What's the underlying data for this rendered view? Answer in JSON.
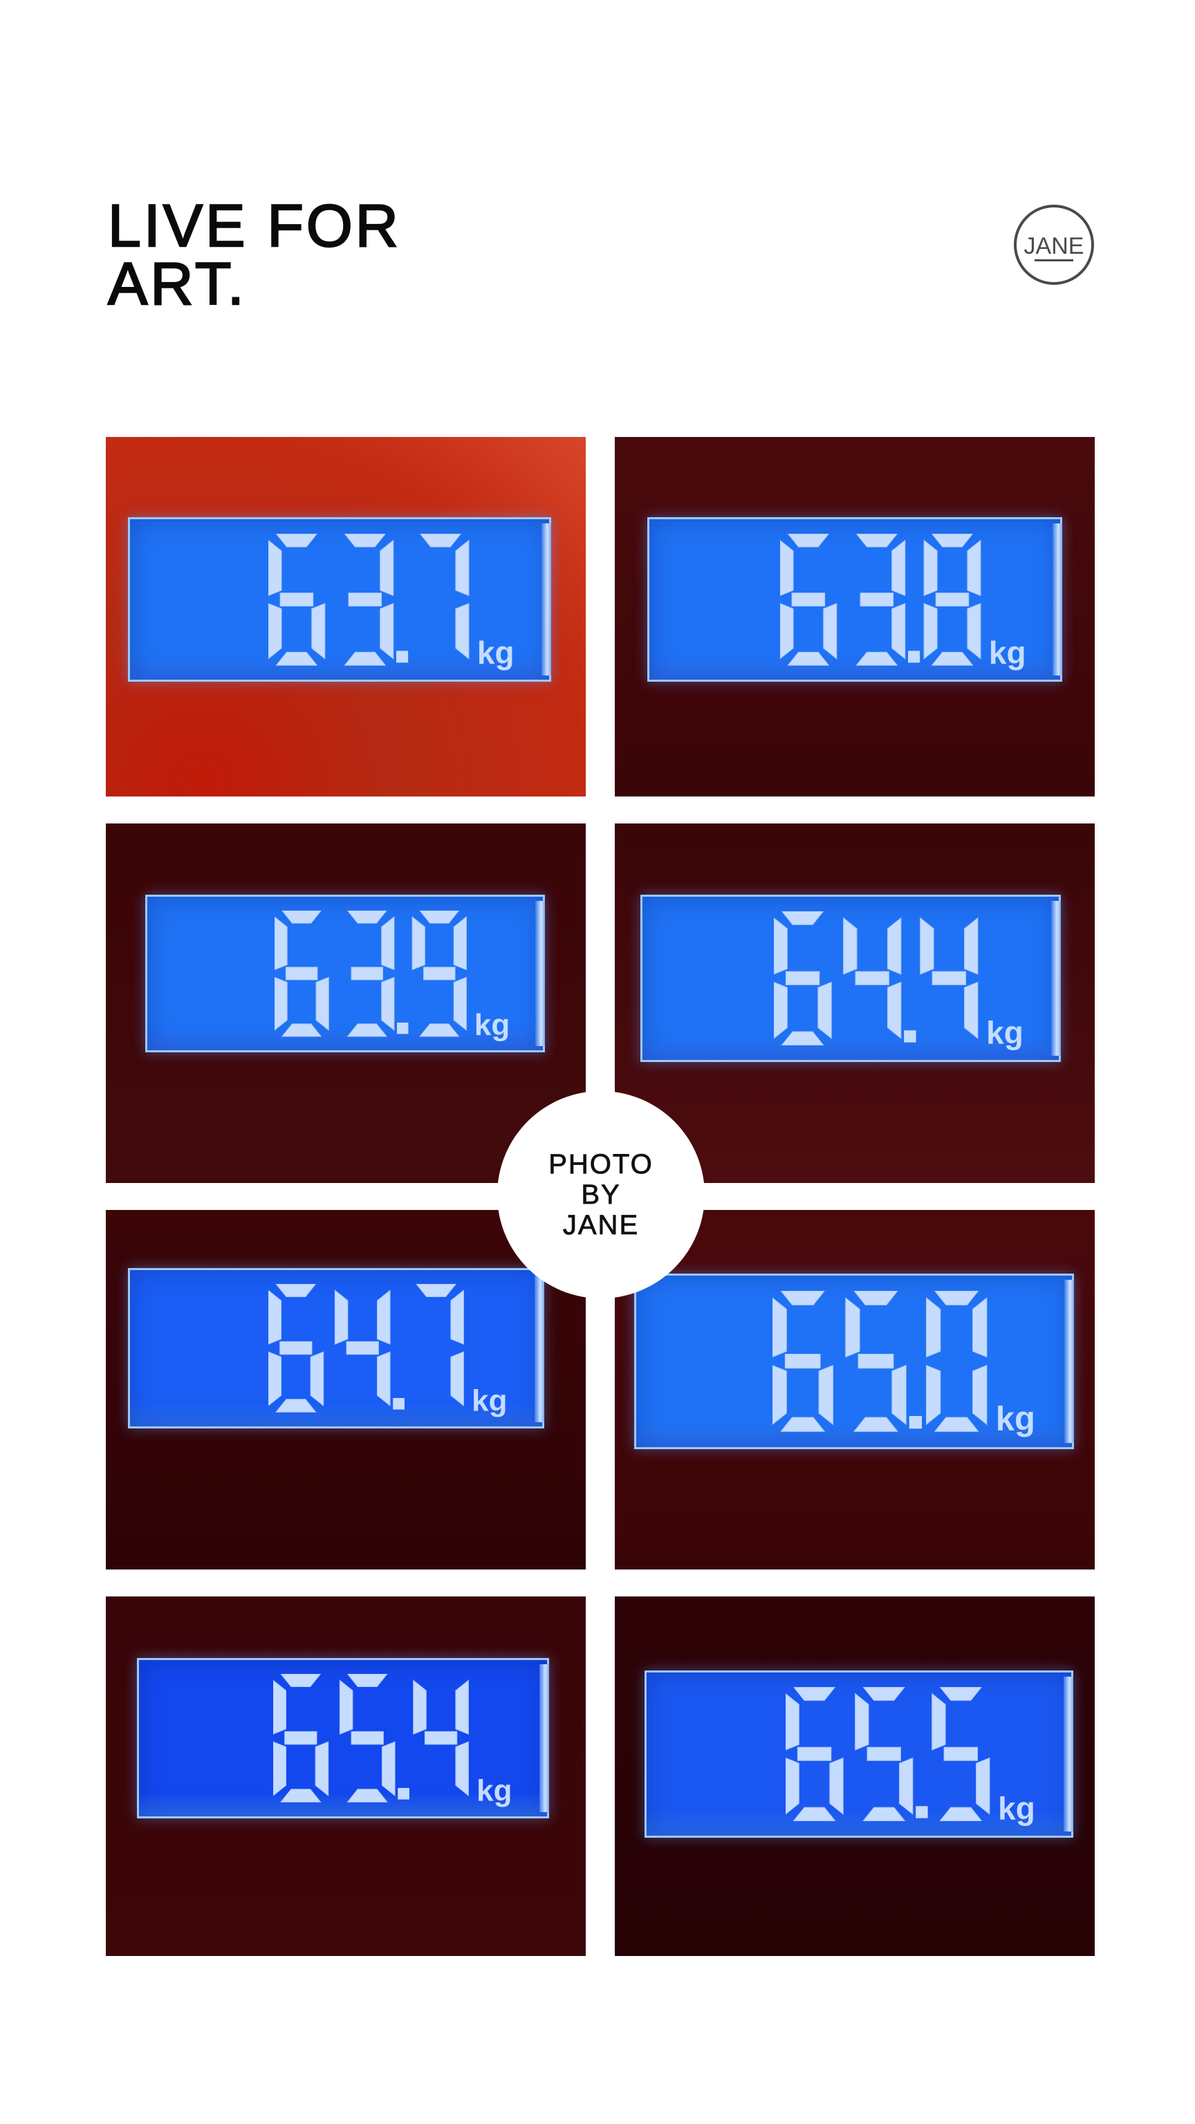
{
  "header": {
    "title_line1": "LIVE FOR",
    "title_line2": "ART."
  },
  "logo": {
    "text": "JANE"
  },
  "badge": {
    "line1": "PHOTO",
    "line2": "BY",
    "line3": "JANE"
  },
  "unit": "kg",
  "readings": [
    {
      "int": "63",
      "dec": "7",
      "value": 63.7
    },
    {
      "int": "63",
      "dec": "8",
      "value": 63.8
    },
    {
      "int": "63",
      "dec": "9",
      "value": 63.9
    },
    {
      "int": "64",
      "dec": "4",
      "value": 64.4
    },
    {
      "int": "64",
      "dec": "7",
      "value": 64.7
    },
    {
      "int": "65",
      "dec": "0",
      "value": 65.0
    },
    {
      "int": "65",
      "dec": "4",
      "value": 65.4
    },
    {
      "int": "65",
      "dec": "5",
      "value": 65.5
    }
  ],
  "colors": {
    "lcd_blue": "#1f72f5",
    "lcd_blue_deep": "#1348ee",
    "segment": "#c6dcff",
    "scale_red": "#c22a12",
    "scale_dark": "#3a0508"
  }
}
